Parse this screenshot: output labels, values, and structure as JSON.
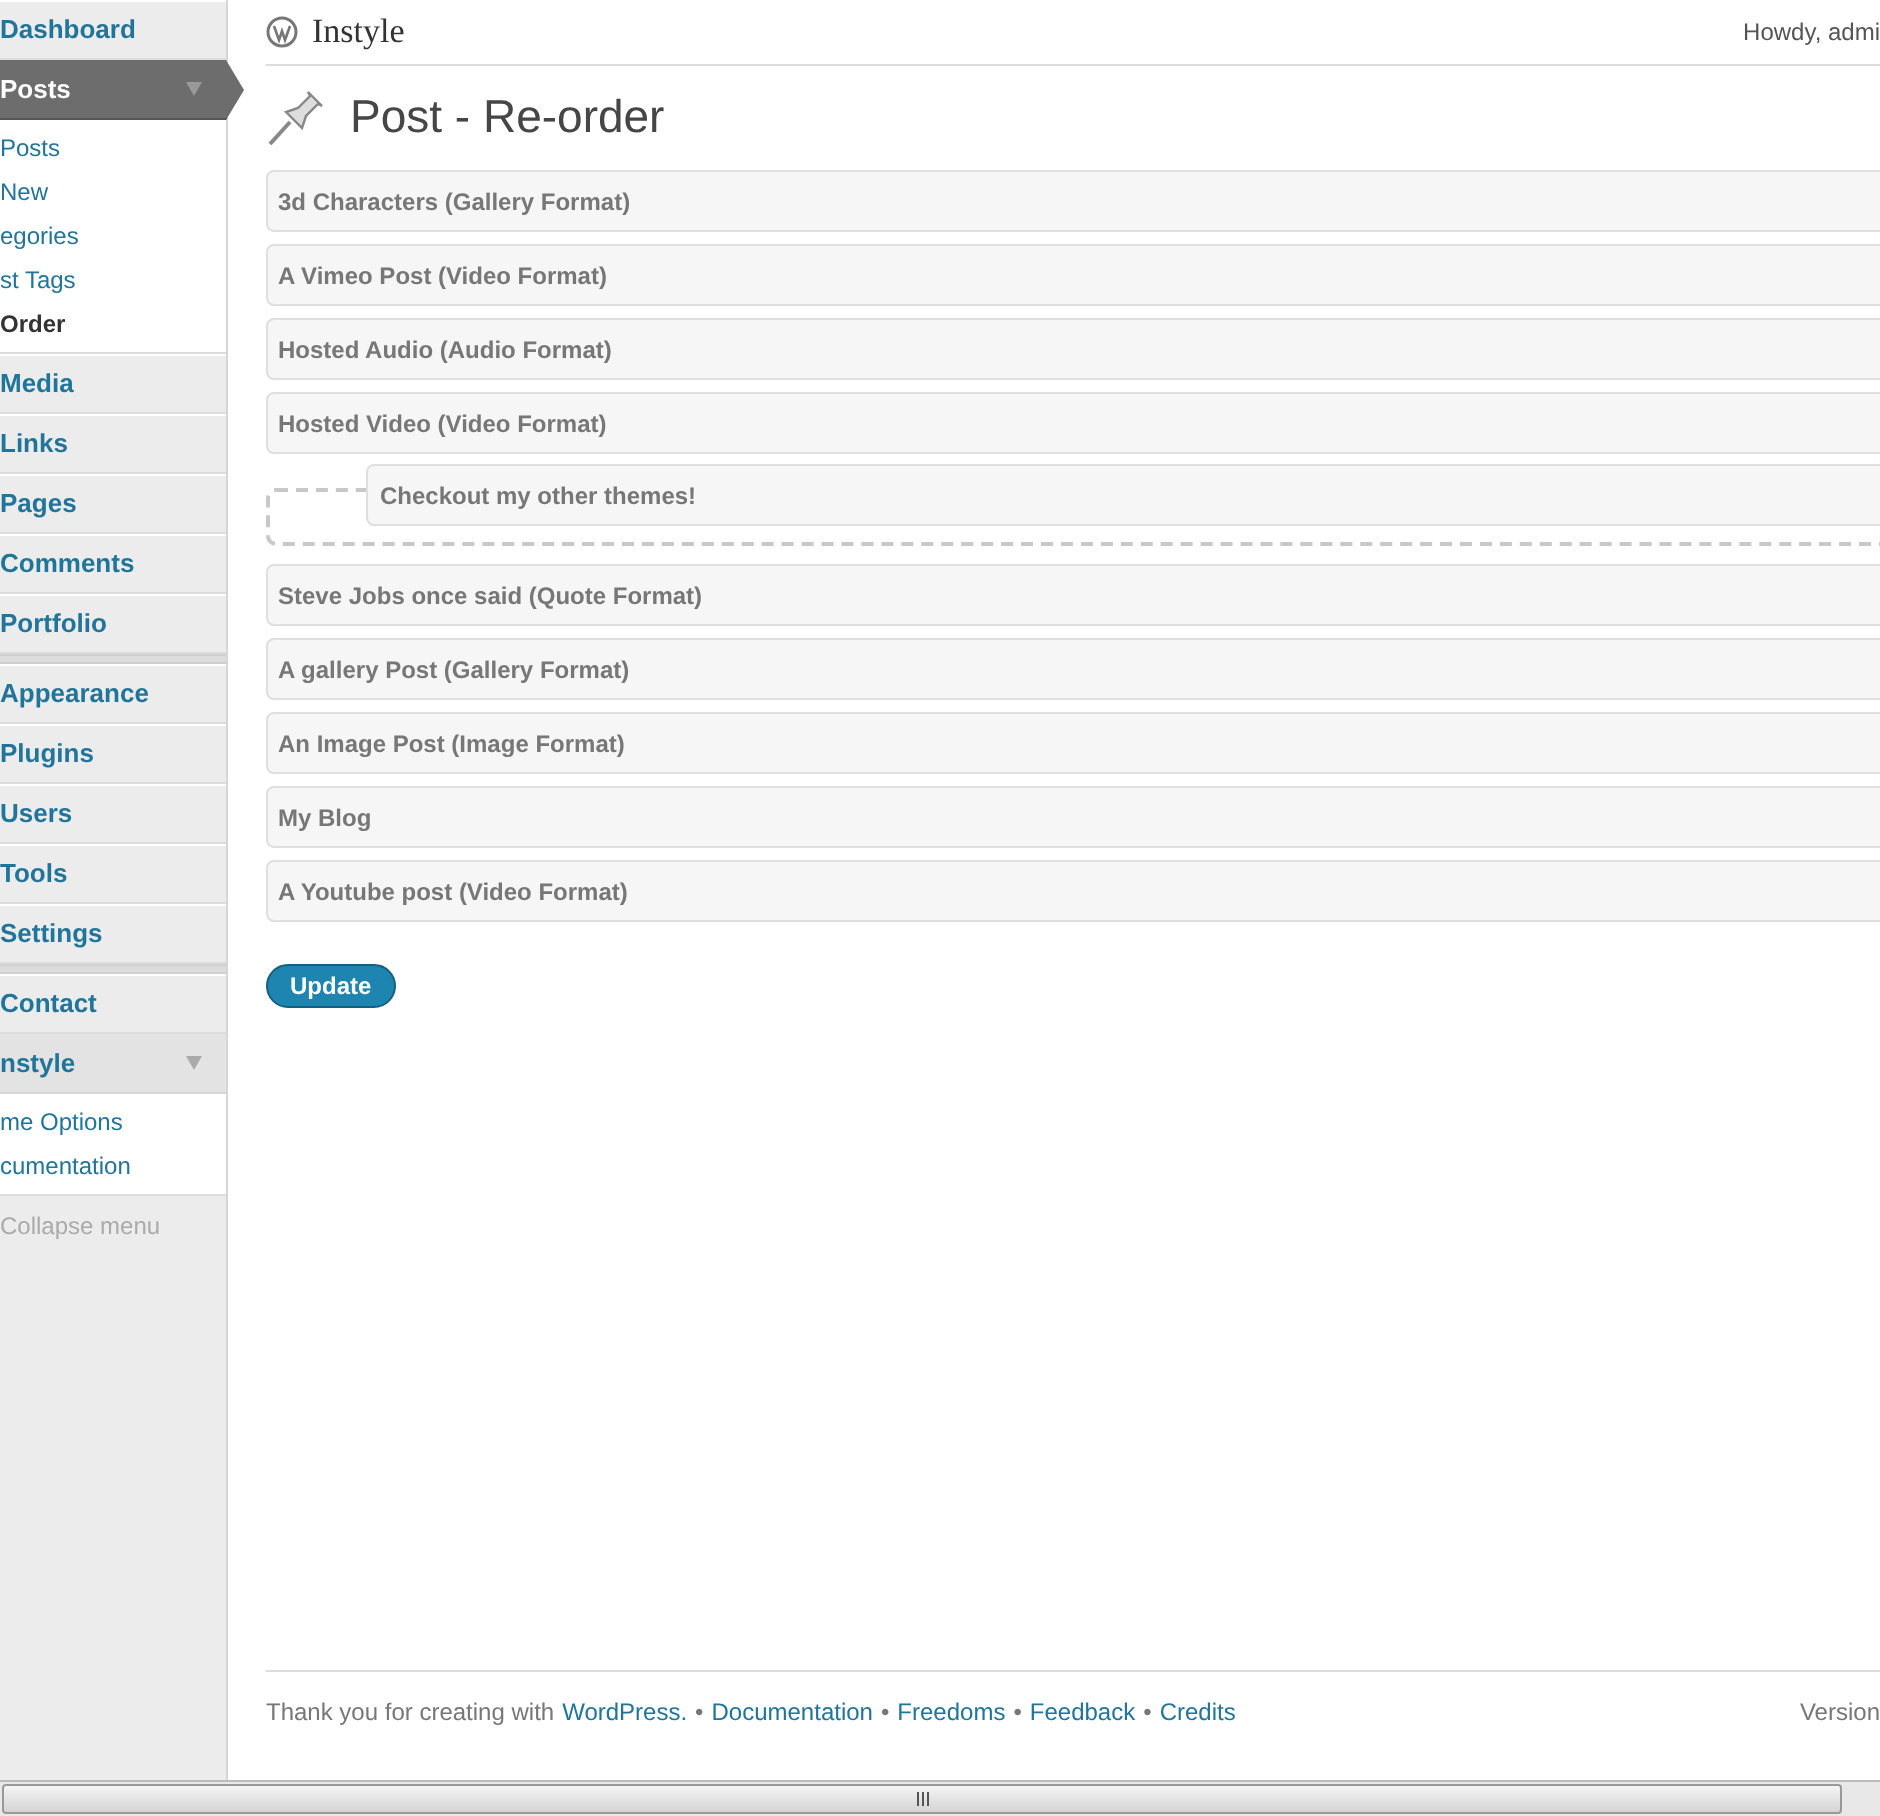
{
  "sidebar": {
    "items": [
      {
        "label": "Dashboard",
        "kind": "menu",
        "current": false,
        "expanded": false
      },
      {
        "label": "Posts",
        "kind": "menu",
        "current": true,
        "expanded": true,
        "children": [
          {
            "label": "Posts",
            "selected": false
          },
          {
            "label": "New",
            "selected": false
          },
          {
            "label": "egories",
            "selected": false
          },
          {
            "label": "st Tags",
            "selected": false
          },
          {
            "label": "Order",
            "selected": true
          }
        ]
      },
      {
        "label": "Media",
        "kind": "menu",
        "current": false,
        "expanded": false
      },
      {
        "label": "Links",
        "kind": "menu",
        "current": false,
        "expanded": false
      },
      {
        "label": "Pages",
        "kind": "menu",
        "current": false,
        "expanded": false
      },
      {
        "label": "Comments",
        "kind": "menu",
        "current": false,
        "expanded": false
      },
      {
        "label": "Portfolio",
        "kind": "menu",
        "current": false,
        "expanded": false
      },
      {
        "kind": "separator"
      },
      {
        "label": "Appearance",
        "kind": "menu",
        "current": false,
        "expanded": false
      },
      {
        "label": "Plugins",
        "kind": "menu",
        "current": false,
        "expanded": false
      },
      {
        "label": "Users",
        "kind": "menu",
        "current": false,
        "expanded": false
      },
      {
        "label": "Tools",
        "kind": "menu",
        "current": false,
        "expanded": false
      },
      {
        "label": "Settings",
        "kind": "menu",
        "current": false,
        "expanded": false
      },
      {
        "kind": "separator"
      },
      {
        "label": "Contact",
        "kind": "menu",
        "current": false,
        "expanded": false
      },
      {
        "label": "nstyle",
        "kind": "menu",
        "current": false,
        "expanded": true,
        "children": [
          {
            "label": "me Options",
            "selected": false
          },
          {
            "label": "cumentation",
            "selected": false
          }
        ]
      },
      {
        "label": "Collapse menu",
        "kind": "collapse"
      }
    ]
  },
  "header": {
    "site_title": "Instyle",
    "greeting": "Howdy, admi"
  },
  "page_title": "Post - Re-order",
  "posts": [
    {
      "kind": "item",
      "title": "3d Characters (Gallery Format)"
    },
    {
      "kind": "item",
      "title": "A Vimeo Post (Video Format)"
    },
    {
      "kind": "item",
      "title": "Hosted Audio (Audio Format)"
    },
    {
      "kind": "item",
      "title": "Hosted Video (Video Format)"
    },
    {
      "kind": "placeholder",
      "title": "Checkout my other themes!"
    },
    {
      "kind": "item",
      "title": "Steve Jobs once said (Quote Format)"
    },
    {
      "kind": "item",
      "title": "A gallery Post (Gallery Format)"
    },
    {
      "kind": "item",
      "title": "An Image Post (Image Format)"
    },
    {
      "kind": "item",
      "title": "My Blog"
    },
    {
      "kind": "item",
      "title": "A Youtube post (Video Format)"
    }
  ],
  "update_button": "Update",
  "footer": {
    "text": "Thank you for creating with",
    "links": [
      "WordPress.",
      "Documentation",
      "Freedoms",
      "Feedback",
      "Credits"
    ],
    "separator": "•",
    "version": "Version"
  }
}
